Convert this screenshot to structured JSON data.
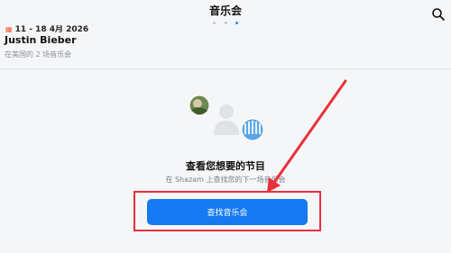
{
  "header": {
    "title": "音乐会",
    "search_icon": "search-icon",
    "page_dots": 3,
    "active_dot": 3
  },
  "concert_card": {
    "date": "11 - 18 4月 2026",
    "artist": "Justin Bieber",
    "subtitle": "在美国的 2 场音乐会",
    "calendar_icon": "calendar-icon"
  },
  "empty_state": {
    "title": "查看您想要的节目",
    "subtitle": "在 Shazam 上查找您的下一场音乐会",
    "button_label": "查找音乐会"
  },
  "colors": {
    "accent": "#1579f2",
    "annotation": "#e8303b"
  }
}
